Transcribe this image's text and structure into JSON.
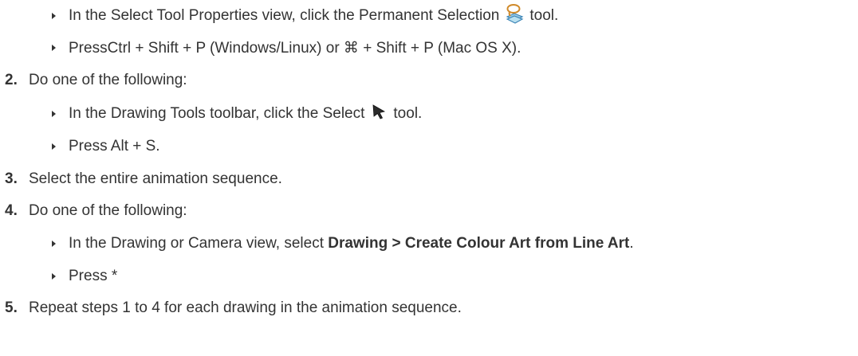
{
  "steps": {
    "step1_bullets": [
      {
        "before": "In the Select Tool Properties view, click the Permanent Selection",
        "icon": "permanent-selection-icon",
        "after": "tool."
      },
      {
        "text": "PressCtrl + Shift + P (Windows/Linux) or ⌘ + Shift + P (Mac OS X)."
      }
    ],
    "step2": {
      "number": "2.",
      "text": "Do one of the following:",
      "bullets": [
        {
          "before": "In the Drawing Tools toolbar, click the Select",
          "icon": "select-arrow-icon",
          "after": "tool."
        },
        {
          "text": "Press Alt + S."
        }
      ]
    },
    "step3": {
      "number": "3.",
      "text": "Select the entire animation sequence."
    },
    "step4": {
      "number": "4.",
      "text": "Do one of the following:",
      "bullets": [
        {
          "before": "In the Drawing or Camera view, select",
          "bold": "Drawing > Create Colour Art from Line Art",
          "after": "."
        },
        {
          "text": "Press *"
        }
      ]
    },
    "step5": {
      "number": "5.",
      "text": "Repeat steps 1 to 4 for each drawing in the animation sequence."
    }
  }
}
